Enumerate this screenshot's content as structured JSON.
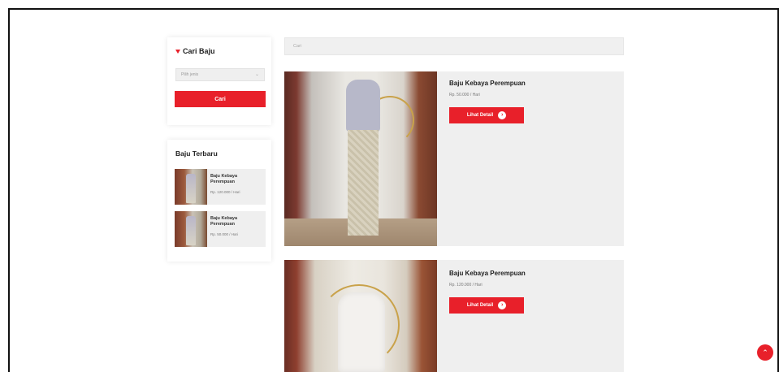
{
  "sidebar": {
    "search": {
      "title": "Cari Baju",
      "select_value": "Pilih jenis",
      "button_label": "Cari"
    },
    "latest": {
      "title": "Baju Terbaru",
      "items": [
        {
          "name": "Baju Kebaya Perempuan",
          "price": "Rp. 120.000 / Hari"
        },
        {
          "name": "Baju Kebaya Perempuan",
          "price": "Rp. 50.000 / Hari"
        }
      ]
    }
  },
  "main": {
    "search_placeholder": "Cari",
    "products": [
      {
        "name": "Baju Kebaya Perempuan",
        "price": "Rp. 50.000 / Hari",
        "button_label": "Lihat Detail"
      },
      {
        "name": "Baju Kebaya Perempuan",
        "price": "Rp. 120.000 / Hari",
        "button_label": "Lihat Detail"
      }
    ]
  },
  "colors": {
    "accent": "#e8202a",
    "card_bg": "#efefef"
  },
  "icons": {
    "filter": "filter-icon",
    "arrow": "arrow-right-icon",
    "scroll_top": "chevron-up-icon"
  }
}
